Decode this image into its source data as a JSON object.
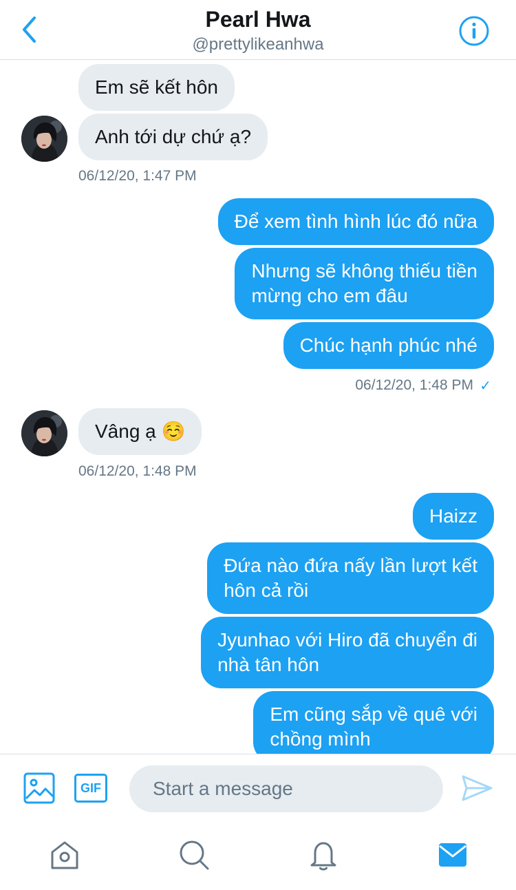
{
  "header": {
    "title": "Pearl Hwa",
    "handle": "@prettylikeanhwa"
  },
  "messages": [
    {
      "dir": "in",
      "text": "Em sẽ kết hôn"
    },
    {
      "dir": "in",
      "text": "Anh tới dự chứ ạ?"
    },
    {
      "dir": "in-ts",
      "text": "06/12/20, 1:47 PM"
    },
    {
      "dir": "out",
      "text": "Để xem tình hình lúc đó nữa"
    },
    {
      "dir": "out",
      "line1": "Nhưng sẽ không thiếu tiền",
      "line2": "mừng cho em đâu"
    },
    {
      "dir": "out",
      "text": "Chúc hạnh phúc nhé"
    },
    {
      "dir": "out-ts",
      "text": "06/12/20, 1:48 PM",
      "status": "✓"
    },
    {
      "dir": "in",
      "text": "Vâng ạ ☺️"
    },
    {
      "dir": "in-ts",
      "text": "06/12/20, 1:48 PM"
    },
    {
      "dir": "out",
      "text": "Haizz"
    },
    {
      "dir": "out",
      "line1": "Đứa nào đứa nấy lần lượt kết",
      "line2": "hôn cả rồi"
    },
    {
      "dir": "out",
      "line1": "Jyunhao với Hiro đã chuyển đi",
      "line2": "nhà tân hôn"
    },
    {
      "dir": "out",
      "line1": "Em cũng sắp về quê với",
      "line2": "chồng mình"
    }
  ],
  "composer": {
    "gif_label": "GIF",
    "placeholder": "Start a message"
  },
  "icons": {
    "back": "chevron-left-icon",
    "info": "info-icon",
    "image": "image-icon",
    "gif": "gif-icon",
    "send": "send-icon",
    "home": "home-icon",
    "search": "search-icon",
    "notifications": "bell-icon",
    "messages": "mail-icon"
  },
  "colors": {
    "accent": "#1da1f2",
    "incoming_bubble": "#e6ecf0",
    "secondary_text": "#657786",
    "tab_inactive": "#657786"
  }
}
